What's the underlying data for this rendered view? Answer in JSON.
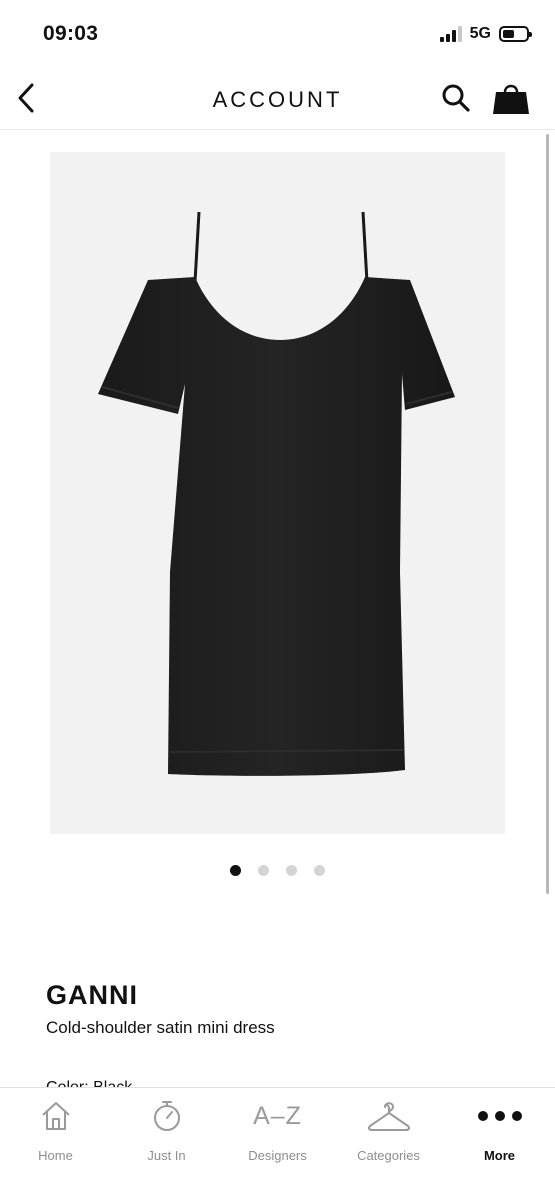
{
  "status_bar": {
    "time": "09:03",
    "network": "5G"
  },
  "header": {
    "title": "ACCOUNT",
    "back_icon": "chevron-left-icon",
    "search_icon": "search-icon",
    "bag_icon": "shopping-bag-icon"
  },
  "product": {
    "image_description_icon": "dress-image",
    "image_count": 4,
    "active_image_index": 0,
    "brand": "GANNI",
    "name": "Cold-shoulder satin mini dress",
    "color_label": "Color: Black"
  },
  "tab_bar": {
    "tabs": [
      {
        "label": "Home",
        "icon": "home-icon",
        "active": false
      },
      {
        "label": "Just In",
        "icon": "stopwatch-icon",
        "active": false
      },
      {
        "label": "Designers",
        "icon": "a-z-icon",
        "icon_text": "A–Z",
        "active": false
      },
      {
        "label": "Categories",
        "icon": "hanger-icon",
        "active": false
      },
      {
        "label": "More",
        "icon": "more-dots-icon",
        "active": true
      }
    ]
  },
  "colors": {
    "accent": "#111111",
    "inactive": "#8e8e8e",
    "image_background": "#f2f2f2"
  }
}
